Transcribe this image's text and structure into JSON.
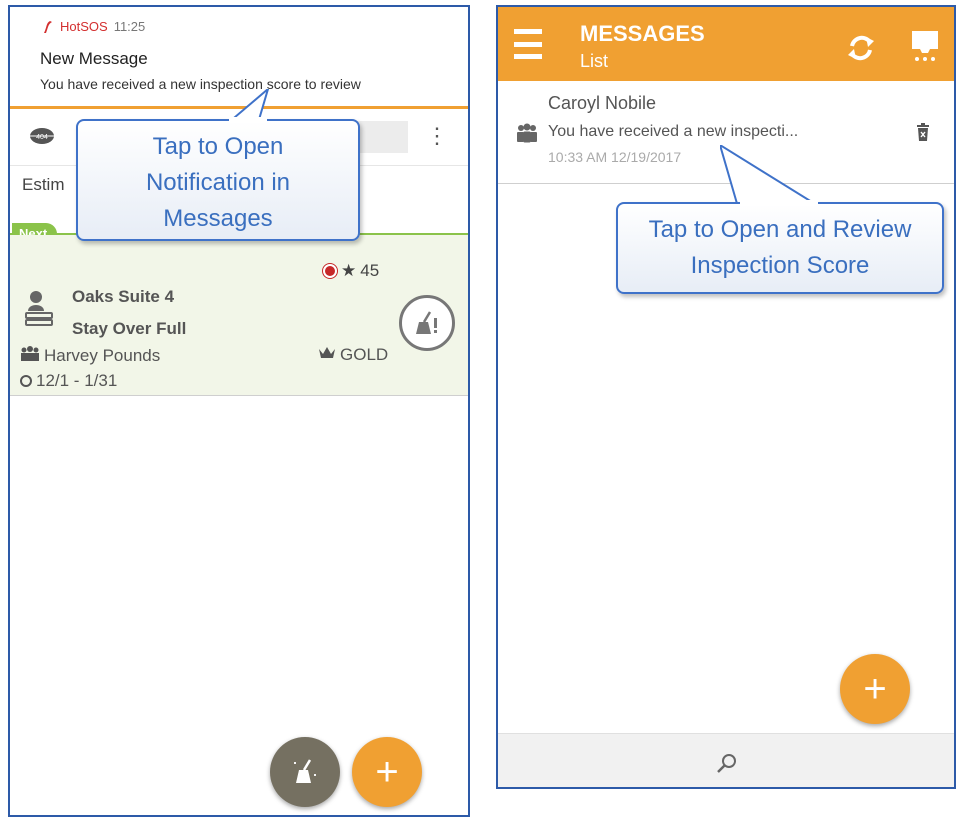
{
  "left_screen": {
    "notification": {
      "app_name": "HotSOS",
      "time": "11:25",
      "title": "New Message",
      "text": "You have received a new inspection score to review"
    },
    "estimate_label": "Estim",
    "next_badge": "Next",
    "task": {
      "score": "45",
      "room": "Oaks Suite 4",
      "status": "Stay Over Full",
      "guest": "Harvey Pounds",
      "vip_level": "GOLD",
      "dates": "12/1 - 1/31"
    },
    "add_label": "+",
    "callout": [
      "Tap to Open",
      "Notification in",
      "Messages"
    ]
  },
  "right_screen": {
    "header": {
      "title": "MESSAGES",
      "subtitle": "List"
    },
    "message": {
      "sender": "Caroyl Nobile",
      "preview": "You have received a new inspecti...",
      "timestamp": "10:33 AM 12/19/2017"
    },
    "add_label": "+",
    "callout": [
      "Tap to Open and Review",
      "Inspection Score"
    ]
  },
  "colors": {
    "accent": "#f0a032",
    "next_green": "#8bc34a",
    "frame_blue": "#2d5aa8",
    "callout_text": "#3a6fbf"
  },
  "icons": [
    "hotsos-logo-icon",
    "overflow-menu-icon",
    "room-404-icon",
    "red-priority-icon",
    "star-icon",
    "housekeeper-icon",
    "cleaning-icon",
    "guest-group-icon",
    "crown-icon",
    "clock-icon",
    "hamburger-menu-icon",
    "refresh-icon",
    "device-icon",
    "people-icon",
    "trash-icon",
    "search-icon",
    "plus-icon"
  ]
}
